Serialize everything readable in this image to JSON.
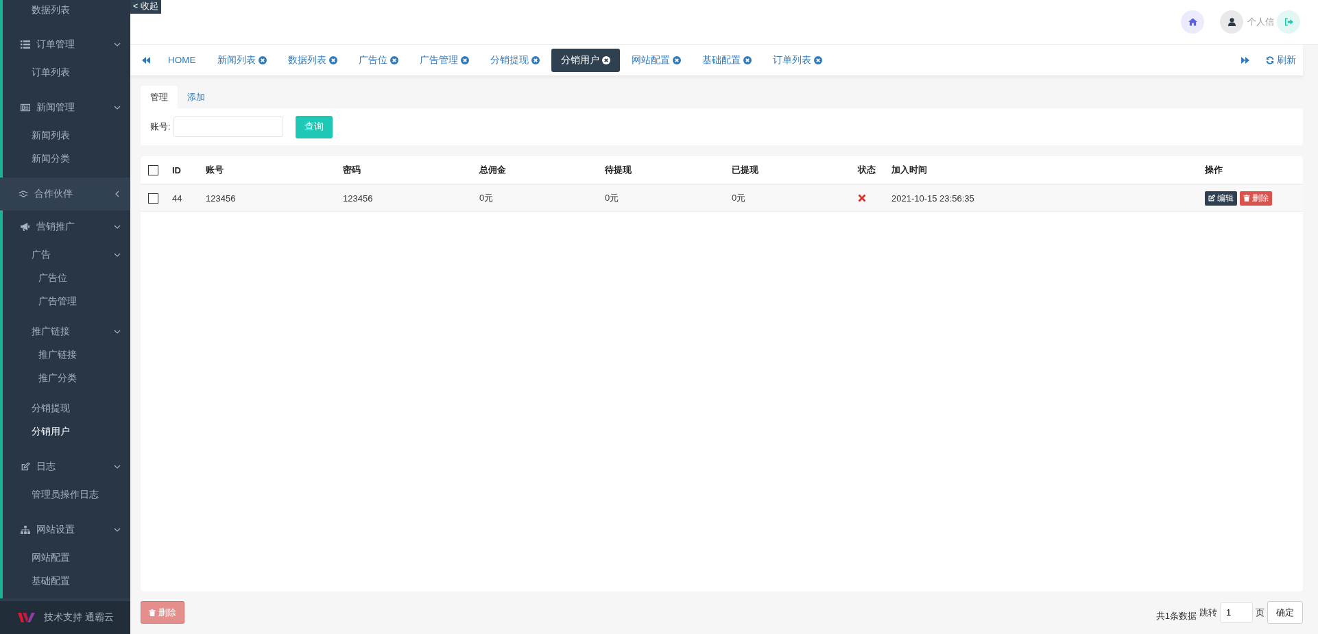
{
  "sidebar": {
    "collapse_button": "< 收起",
    "items": [
      {
        "kind": "link",
        "label": "数据列表",
        "selected": false
      },
      {
        "kind": "group",
        "label": "订单管理",
        "expanded": true,
        "children": [
          {
            "kind": "link",
            "label": "订单列表",
            "selected": false
          }
        ]
      },
      {
        "kind": "group",
        "label": "新闻管理",
        "expanded": true,
        "children": [
          {
            "kind": "link",
            "label": "新闻列表",
            "selected": false
          },
          {
            "kind": "link",
            "label": "新闻分类",
            "selected": false
          }
        ]
      },
      {
        "kind": "group",
        "label": "合作伙伴",
        "expanded": false
      },
      {
        "kind": "group",
        "label": "营销推广",
        "expanded": true,
        "children": [
          {
            "kind": "group",
            "label": "广告",
            "expanded": true,
            "children": [
              {
                "kind": "link",
                "label": "广告位",
                "selected": false
              },
              {
                "kind": "link",
                "label": "广告管理",
                "selected": false
              }
            ]
          },
          {
            "kind": "group",
            "label": "推广链接",
            "expanded": true,
            "children": [
              {
                "kind": "link",
                "label": "推广链接",
                "selected": false
              },
              {
                "kind": "link",
                "label": "推广分类",
                "selected": false
              }
            ]
          },
          {
            "kind": "link",
            "label": "分销提现",
            "selected": false
          },
          {
            "kind": "link",
            "label": "分销用户",
            "selected": true
          }
        ]
      },
      {
        "kind": "group",
        "label": "日志",
        "expanded": true,
        "children": [
          {
            "kind": "link",
            "label": "管理员操作日志",
            "selected": false
          }
        ]
      },
      {
        "kind": "group",
        "label": "网站设置",
        "expanded": true,
        "children": [
          {
            "kind": "link",
            "label": "网站配置",
            "selected": false
          },
          {
            "kind": "link",
            "label": "基础配置",
            "selected": false
          }
        ]
      }
    ],
    "footer": "技术支持 通霸云"
  },
  "header": {
    "user_label": "个人信"
  },
  "page_tabs": [
    {
      "label": "HOME",
      "closable": false,
      "selected": false
    },
    {
      "label": "新闻列表",
      "closable": true,
      "selected": false
    },
    {
      "label": "数据列表",
      "closable": true,
      "selected": false
    },
    {
      "label": "广告位",
      "closable": true,
      "selected": false
    },
    {
      "label": "广告管理",
      "closable": true,
      "selected": false
    },
    {
      "label": "分销提现",
      "closable": true,
      "selected": false
    },
    {
      "label": "分销用户",
      "closable": true,
      "selected": true
    },
    {
      "label": "网站配置",
      "closable": true,
      "selected": false
    },
    {
      "label": "基础配置",
      "closable": true,
      "selected": false
    },
    {
      "label": "订单列表",
      "closable": true,
      "selected": false
    }
  ],
  "refresh_button": "刷新",
  "sub_tabs": [
    {
      "label": "管理",
      "selected": true
    },
    {
      "label": "添加",
      "selected": false
    }
  ],
  "search": {
    "label": "账号:",
    "button": "查询"
  },
  "table": {
    "select_all_checked": false,
    "columns": [
      "ID",
      "账号",
      "密码",
      "总佣金",
      "待提现",
      "已提现",
      "状态",
      "加入时间",
      "操作"
    ],
    "rows": [
      {
        "checked": false,
        "id": "44",
        "account": "123456",
        "password": "123456",
        "total_commission": "0元",
        "pending": "0元",
        "withdrawn": "0元",
        "status": false,
        "joined": "2021-10-15 23:56:35",
        "actions": [
          "编辑",
          "删除"
        ]
      }
    ]
  },
  "footer": {
    "delete_button": "删除",
    "total": "共1条数据",
    "jump_label": "跳转",
    "page_value": "1",
    "page_unit": "页",
    "confirm_button": "确定"
  }
}
